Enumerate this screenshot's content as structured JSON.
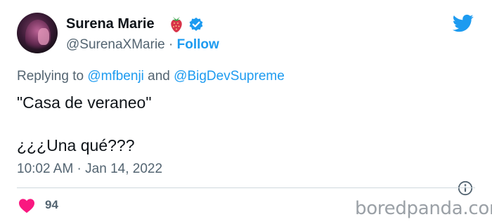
{
  "author": {
    "display_name": "Surena Marie",
    "handle": "@SurenaXMarie",
    "separator": "·",
    "follow_label": "Follow",
    "name_emoji": "strawberry-icon",
    "verified": true
  },
  "reply": {
    "prefix": "Replying to",
    "mentions": [
      "@mfbenji",
      "@BigDevSupreme"
    ],
    "conjunction": "and"
  },
  "tweet": {
    "lines": [
      "\"Casa de veraneo\"",
      "¿¿¿Una qué???"
    ],
    "timestamp": "10:02 AM · Jan 14, 2022"
  },
  "actions": {
    "like_count": "94"
  },
  "watermark": "boredpanda.com",
  "colors": {
    "accent": "#1d9bf0",
    "heart": "#f91880",
    "secondary_text": "#536471",
    "divider": "#cfd9de"
  }
}
